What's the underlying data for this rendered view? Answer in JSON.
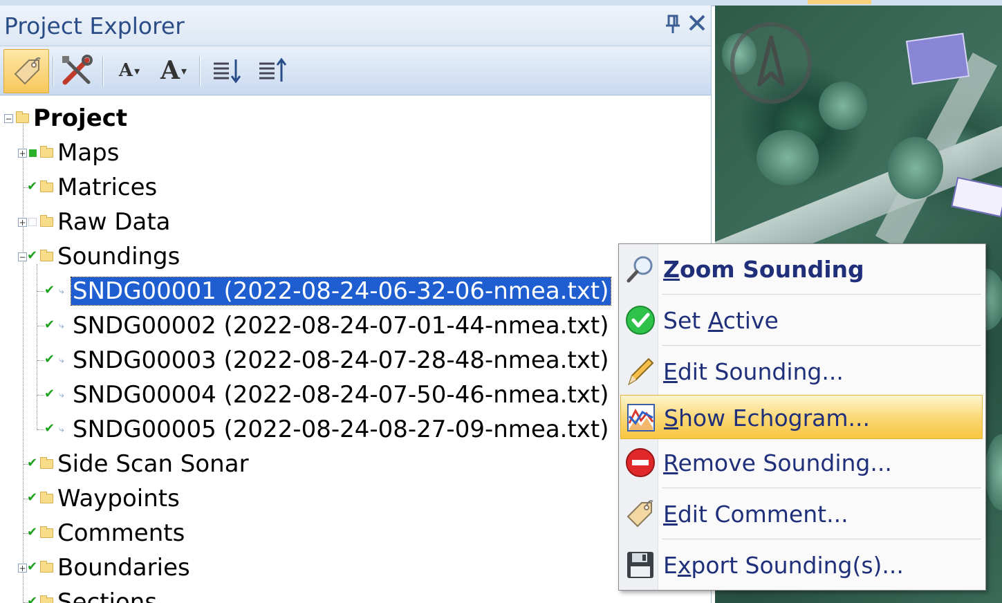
{
  "panel": {
    "title": "Project Explorer",
    "pin_glyph": "⊥",
    "close_glyph": "✕"
  },
  "toolbar": {
    "items": [
      {
        "icon": "tag-icon",
        "active": true
      },
      {
        "icon": "tools-icon",
        "active": false
      },
      {
        "icon": "decrease-font-icon",
        "glyph": "A"
      },
      {
        "icon": "increase-font-icon",
        "glyph": "A"
      },
      {
        "icon": "sort-ascending-icon"
      },
      {
        "icon": "sort-descending-icon"
      }
    ],
    "font_small_glyph": "A",
    "font_large_glyph": "A"
  },
  "tree": {
    "root": "Project",
    "maps": "Maps",
    "matrices": "Matrices",
    "raw_data": "Raw Data",
    "soundings": "Soundings",
    "sounding_items": [
      "SNDG00001 (2022-08-24-06-32-06-nmea.txt)",
      "SNDG00002 (2022-08-24-07-01-44-nmea.txt)",
      "SNDG00003 (2022-08-24-07-28-48-nmea.txt)",
      "SNDG00004 (2022-08-24-07-50-46-nmea.txt)",
      "SNDG00005 (2022-08-24-08-27-09-nmea.txt)"
    ],
    "side_scan": "Side Scan Sonar",
    "waypoints": "Waypoints",
    "comments": "Comments",
    "boundaries": "Boundaries",
    "sections": "Sections"
  },
  "context_menu": {
    "zoom_pre": "",
    "zoom_u": "Z",
    "zoom_post": "oom Sounding",
    "active_pre": "Set ",
    "active_u": "A",
    "active_post": "ctive",
    "edit_pre": "",
    "edit_u": "E",
    "edit_post": "dit Sounding...",
    "echo_pre": "",
    "echo_u": "S",
    "echo_post": "how Echogram...",
    "remove_pre": "",
    "remove_u": "R",
    "remove_post": "emove Sounding...",
    "comment_pre": "",
    "comment_u": "E",
    "comment_post": "dit Comment...",
    "export_pre": "E",
    "export_u": "x",
    "export_post": "port Sounding(s)..."
  },
  "colors": {
    "selection": "#1f5ed1",
    "title_text": "#2a4d87",
    "menu_text": "#1f2f7a",
    "menu_highlight": "#fbd978"
  }
}
